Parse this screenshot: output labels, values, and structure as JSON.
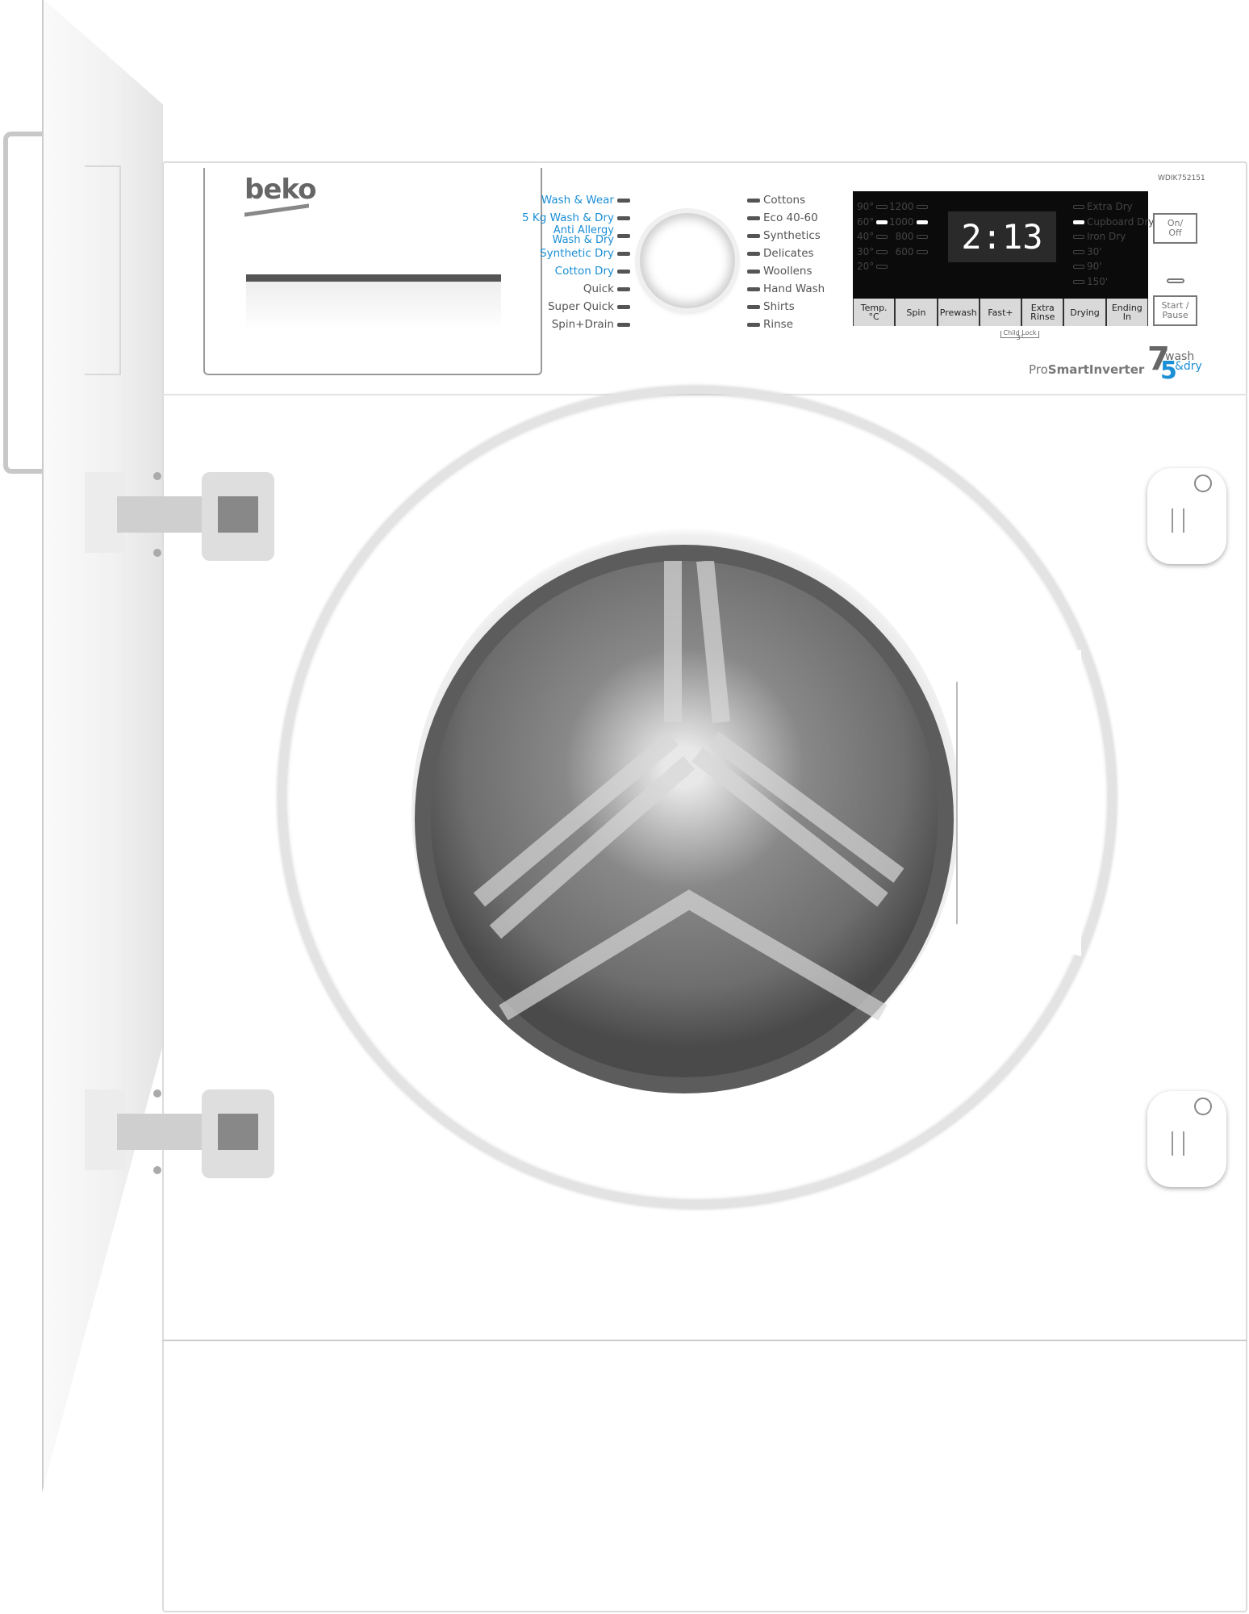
{
  "brand": "beko",
  "model": "WDIK752151",
  "programs_left": [
    {
      "label": "Wash & Wear",
      "color": "blue"
    },
    {
      "label": "5 Kg Wash & Dry",
      "color": "blue"
    },
    {
      "label": "Anti Allergy Wash & Dry",
      "color": "blue"
    },
    {
      "label": "Synthetic Dry",
      "color": "blue"
    },
    {
      "label": "Cotton Dry",
      "color": "blue"
    },
    {
      "label": "Quick",
      "color": "grey"
    },
    {
      "label": "Super Quick",
      "color": "grey"
    },
    {
      "label": "Spin+Drain",
      "color": "grey"
    }
  ],
  "programs_right": [
    "Cottons",
    "Eco 40-60",
    "Synthetics",
    "Delicates",
    "Woollens",
    "Hand Wash",
    "Shirts",
    "Rinse"
  ],
  "display": {
    "temps": [
      "90°",
      "60°",
      "40°",
      "30°",
      "20°"
    ],
    "temp_selected": "60°",
    "spins": [
      "1200",
      "1000",
      "800",
      "600"
    ],
    "spin_selected": "1000",
    "dry_options": [
      "Extra Dry",
      "Cupboard Dry",
      "Iron Dry",
      "30'",
      "90'",
      "150'"
    ],
    "dry_selected": "Cupboard Dry",
    "time": "2:13"
  },
  "buttons": [
    "Temp.\n°C",
    "Spin",
    "Prewash",
    "Fast+",
    "Extra\nRinse",
    "Drying",
    "Ending In"
  ],
  "child_lock": "Child Lock 3\"",
  "on_off": "On/\nOff",
  "start_pause": "Start /\nPause",
  "tech_pro": "Pro",
  "tech_main": "SmartInverter",
  "capacity": {
    "wash": "7",
    "dry": "5",
    "wash_label": "wash",
    "dry_label": "&dry"
  },
  "colors": {
    "accent_blue": "#1b8fd6",
    "display_bg": "#0b0b0b"
  }
}
